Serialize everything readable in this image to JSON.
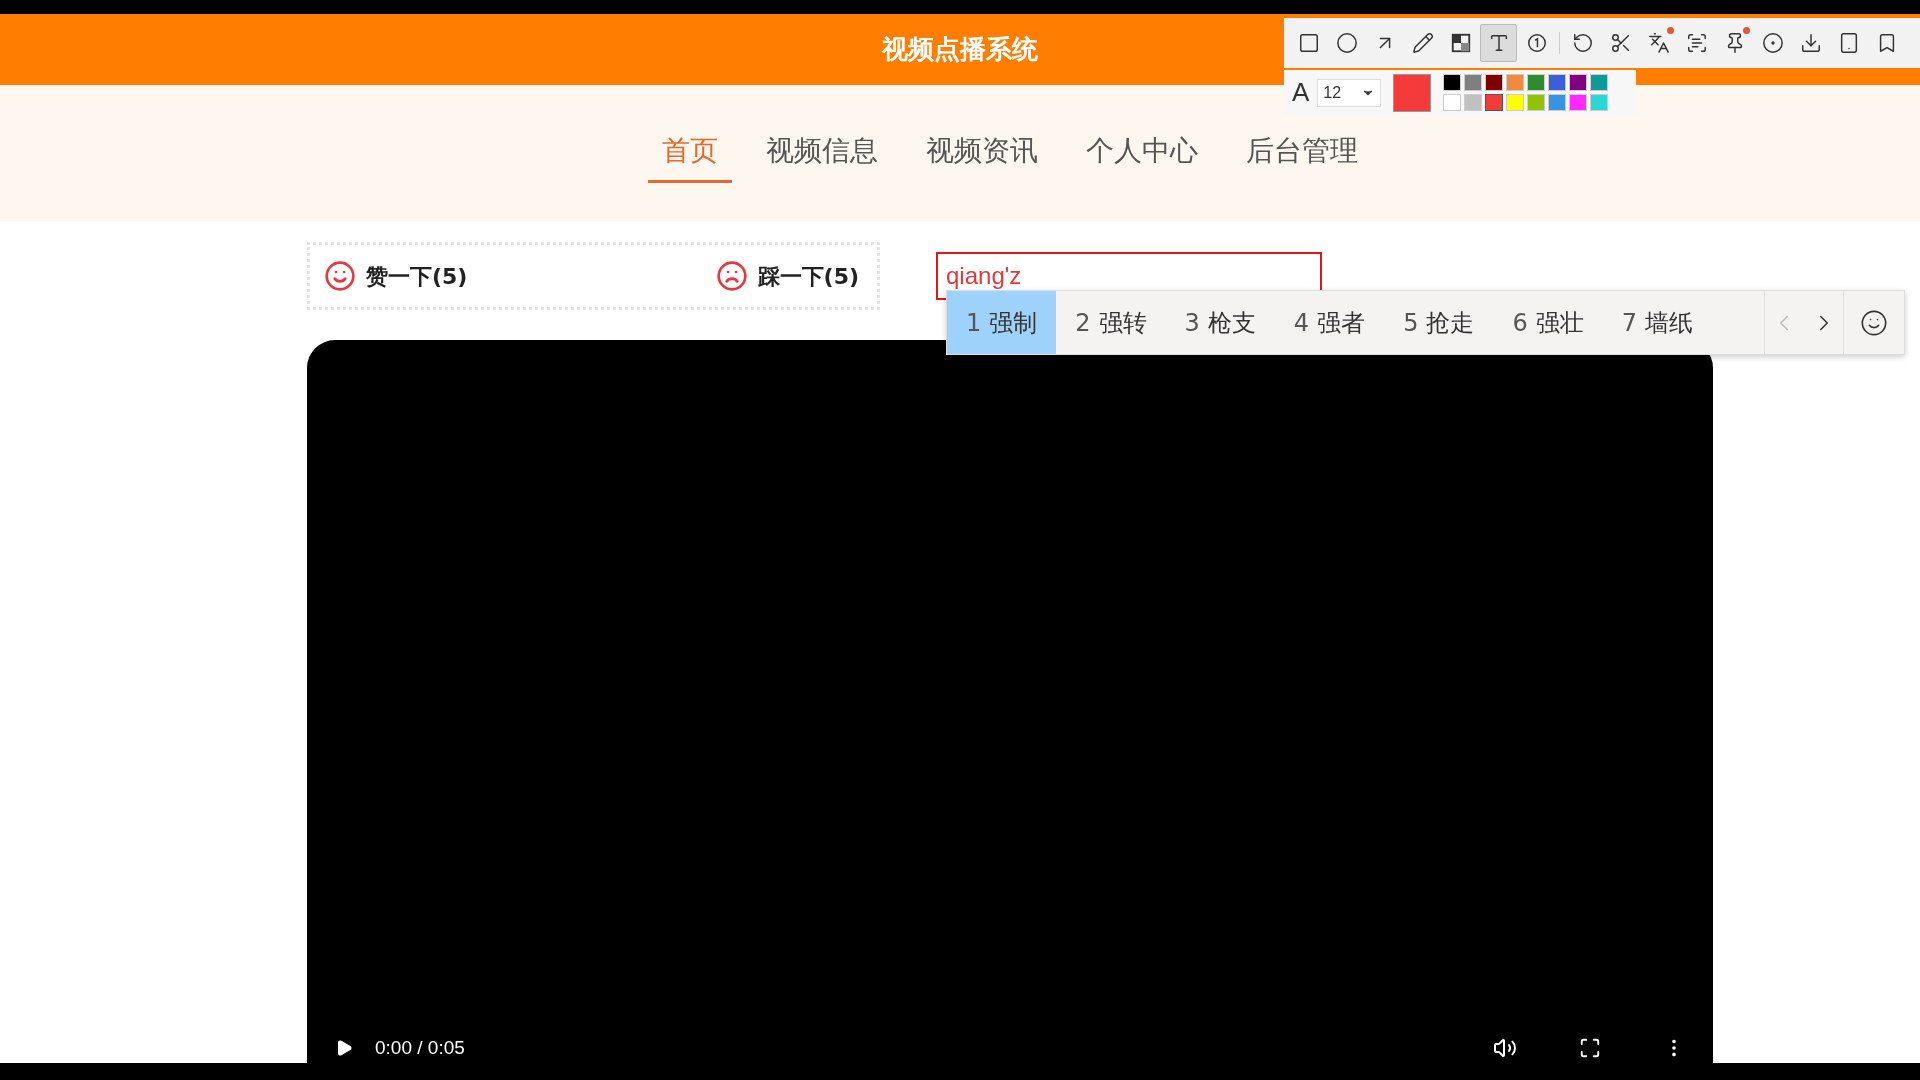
{
  "header": {
    "title": "视频点播系统"
  },
  "capture_toolbar": {
    "tools": [
      {
        "selected": false,
        "badge": false
      },
      {
        "selected": false,
        "badge": false
      },
      {
        "selected": false,
        "badge": false
      },
      {
        "selected": false,
        "badge": false
      },
      {
        "selected": false,
        "badge": false
      },
      {
        "selected": true,
        "badge": false
      },
      {
        "selected": false,
        "badge": false
      },
      {
        "selected": false,
        "badge": false
      },
      {
        "selected": false,
        "badge": false
      },
      {
        "selected": false,
        "badge": true
      },
      {
        "selected": false,
        "badge": false
      },
      {
        "selected": false,
        "badge": true
      },
      {
        "selected": false,
        "badge": false
      },
      {
        "selected": false,
        "badge": false
      },
      {
        "selected": false,
        "badge": false
      },
      {
        "selected": false,
        "badge": false
      }
    ],
    "font_label": "A",
    "font_size": "12",
    "swatches": [
      {
        "color": "#000000",
        "selected": false
      },
      {
        "color": "#7f7f7f",
        "selected": false
      },
      {
        "color": "#7f0000",
        "selected": false
      },
      {
        "color": "#f08a3c",
        "selected": false
      },
      {
        "color": "#2e8b2e",
        "selected": false
      },
      {
        "color": "#3a5fd6",
        "selected": false
      },
      {
        "color": "#800080",
        "selected": false
      },
      {
        "color": "#0f9a9a",
        "selected": false
      },
      {
        "color": "#ffffff",
        "selected": false
      },
      {
        "color": "#c0c0c0",
        "selected": false
      },
      {
        "color": "#f53a3a",
        "selected": true
      },
      {
        "color": "#ffff00",
        "selected": false
      },
      {
        "color": "#8ec400",
        "selected": false
      },
      {
        "color": "#3894e0",
        "selected": false
      },
      {
        "color": "#ff29ff",
        "selected": false
      },
      {
        "color": "#2ad6d6",
        "selected": false
      }
    ]
  },
  "nav": [
    {
      "label": "首页",
      "selected": true
    },
    {
      "label": "视频信息",
      "selected": false
    },
    {
      "label": "视频资讯",
      "selected": false
    },
    {
      "label": "个人中心",
      "selected": false
    },
    {
      "label": "后台管理",
      "selected": false
    }
  ],
  "votes": [
    {
      "kind": "like",
      "label": "赞一下(5)"
    },
    {
      "kind": "dislike",
      "label": "踩一下(5)"
    }
  ],
  "comment_input": {
    "value": "qiang'z"
  },
  "ime": {
    "candidates": [
      {
        "number": "1",
        "word": "强制",
        "selected": true
      },
      {
        "number": "2",
        "word": "强转",
        "selected": false
      },
      {
        "number": "3",
        "word": "枪支",
        "selected": false
      },
      {
        "number": "4",
        "word": "强者",
        "selected": false
      },
      {
        "number": "5",
        "word": "抢走",
        "selected": false
      },
      {
        "number": "6",
        "word": "强壮",
        "selected": false
      },
      {
        "number": "7",
        "word": "墙纸",
        "selected": false
      }
    ],
    "prev": {
      "disabled": true
    },
    "next": {
      "disabled": false
    }
  },
  "video": {
    "time": "0:00 / 0:05"
  }
}
